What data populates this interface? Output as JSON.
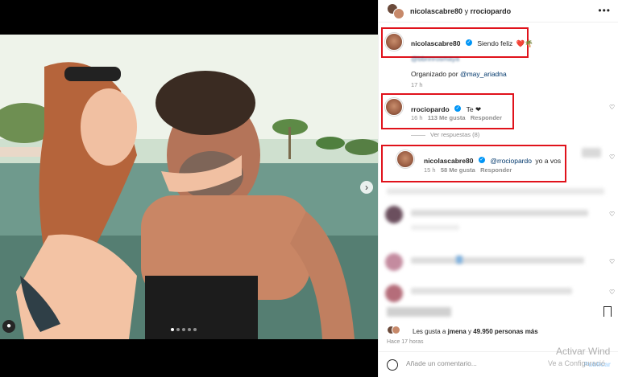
{
  "header": {
    "user1": "nicolascabre80",
    "joiner": "y",
    "user2": "rrociopardo",
    "more_icon": "more-horizontal-icon"
  },
  "caption": {
    "username": "nicolascabre80",
    "text": "Siendo feliz",
    "emojis": "❤️🌴",
    "tag_line": "@bbnnrosmaya",
    "organized_prefix": "Organizado por",
    "organized_mention": "@may_ariadna",
    "time": "17 h"
  },
  "comment1": {
    "username": "rrociopardo",
    "text": "Te ❤",
    "time": "16 h",
    "likes": "113 Me gusta",
    "reply": "Responder",
    "view_replies": "Ver respuestas (8)"
  },
  "reply1": {
    "username": "nicolascabre80",
    "mention": "@rrociopardo",
    "text": "yo a vos",
    "time": "15 h",
    "likes": "58 Me gusta",
    "reply": "Responder"
  },
  "footer": {
    "likes_prefix": "Les gusta a",
    "likes_user": "jmena",
    "likes_mid": "y",
    "likes_count": "49.950 personas más",
    "time": "Hace 17 horas",
    "comment_placeholder": "Añade un comentario...",
    "publish": "Publicar"
  },
  "watermark": {
    "line1": "Activar Wind",
    "line2": "Ve a Configuració"
  },
  "colors": {
    "highlight_box": "#e0121b",
    "verified": "#0095f6",
    "link": "#00376b"
  }
}
